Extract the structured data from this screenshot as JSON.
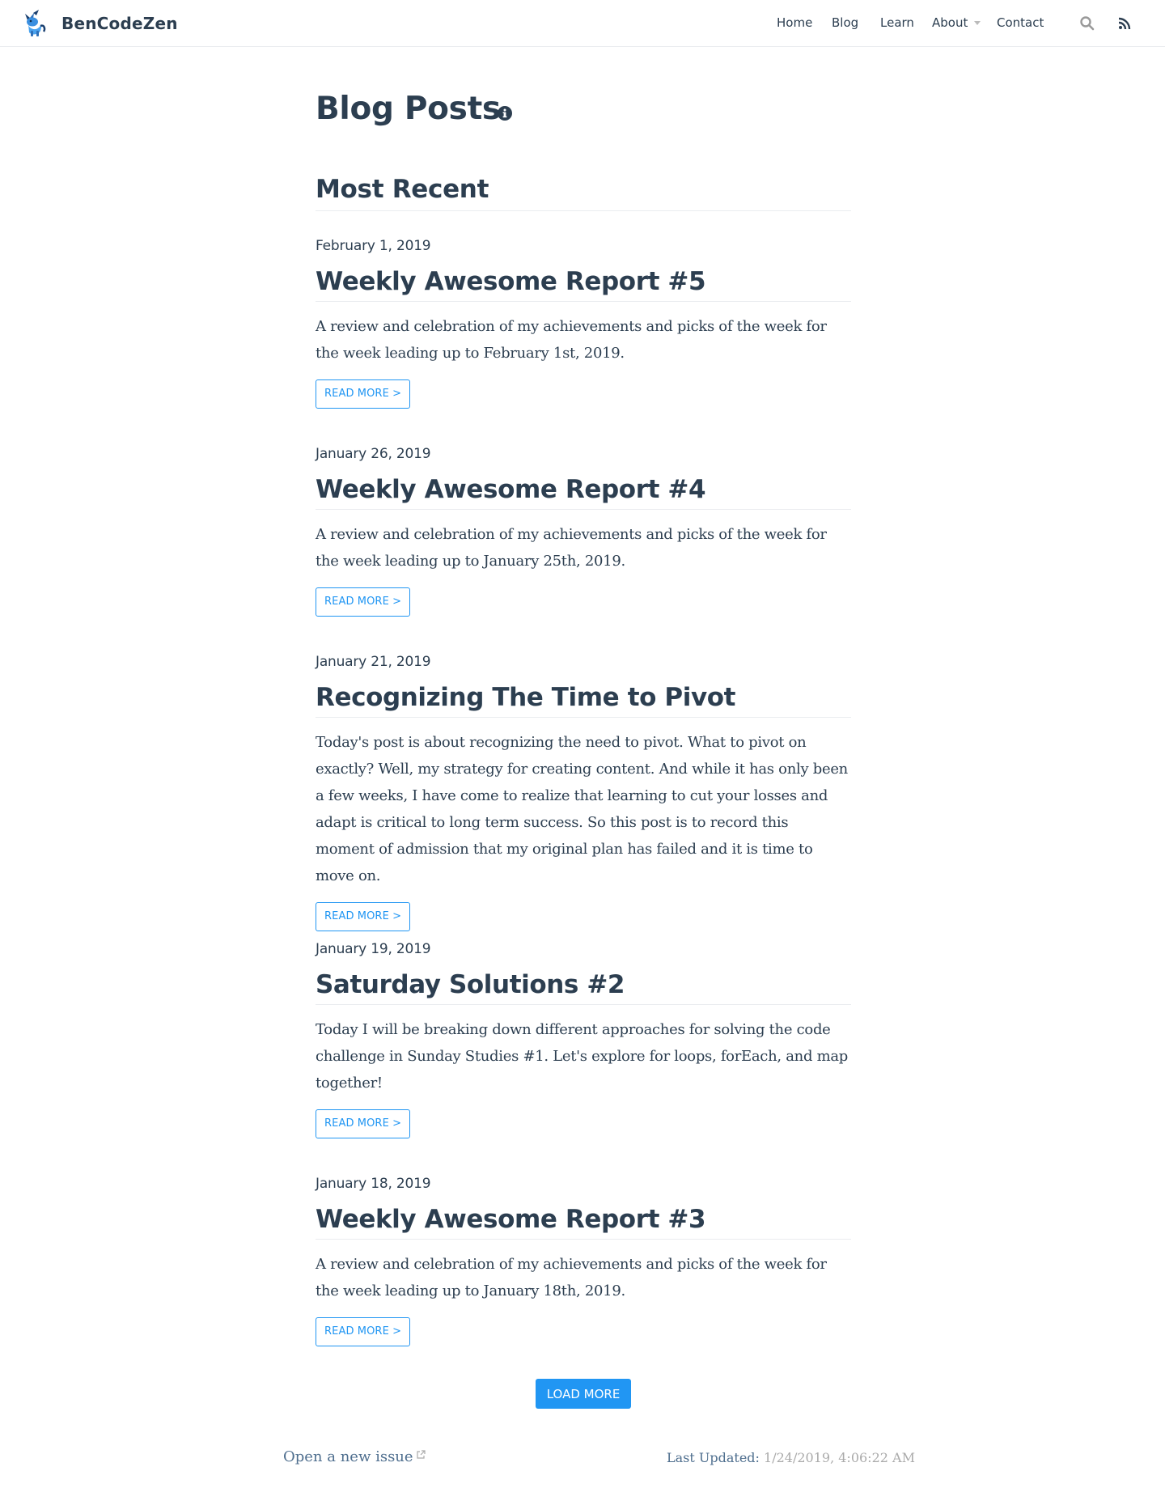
{
  "brand": {
    "name": "BenCodeZen",
    "logo_icon": "unicorn-logo-icon"
  },
  "nav": {
    "items": [
      {
        "label": "Home"
      },
      {
        "label": "Blog"
      },
      {
        "label": "Learn"
      },
      {
        "label": "About"
      },
      {
        "label": "Contact"
      }
    ],
    "search_icon": "search-icon",
    "rss_icon": "rss-icon"
  },
  "page": {
    "title": "Blog Posts",
    "info_icon": "info-icon",
    "section_title": "Most Recent"
  },
  "posts": [
    {
      "date": "February 1, 2019",
      "title": "Weekly Awesome Report #5",
      "excerpt": "A review and celebration of my achievements and picks of the week for the week leading up to February 1st, 2019.",
      "read_more": "READ MORE >"
    },
    {
      "date": "January 26, 2019",
      "title": "Weekly Awesome Report #4",
      "excerpt": "A review and celebration of my achievements and picks of the week for the week leading up to January 25th, 2019.",
      "read_more": "READ MORE >"
    },
    {
      "date": "January 21, 2019",
      "title": "Recognizing The Time to Pivot",
      "excerpt": "Today's post is about recognizing the need to pivot. What to pivot on exactly? Well, my strategy for creating content. And while it has only been a few weeks, I have come to realize that learning to cut your losses and adapt is critical to long term success. So this post is to record this moment of admission that my original plan has failed and it is time to move on.",
      "read_more": "READ MORE >"
    },
    {
      "date": "January 19, 2019",
      "title": "Saturday Solutions #2",
      "excerpt": "Today I will be breaking down different approaches for solving the code challenge in Sunday Studies #1. Let's explore for loops, forEach, and map together!",
      "read_more": "READ MORE >"
    },
    {
      "date": "January 18, 2019",
      "title": "Weekly Awesome Report #3",
      "excerpt": "A review and celebration of my achievements and picks of the week for the week leading up to January 18th, 2019.",
      "read_more": "READ MORE >"
    }
  ],
  "load_more": "LOAD MORE",
  "footer": {
    "issue_link": "Open a new issue",
    "issue_icon": "external-link-icon",
    "updated_label": "Last Updated:",
    "updated_value": "1/24/2019, 4:06:22 AM"
  },
  "colors": {
    "text": "#2c3e50",
    "accent": "#2196f3",
    "border": "#eaecef",
    "muted": "#aaaaaa"
  }
}
